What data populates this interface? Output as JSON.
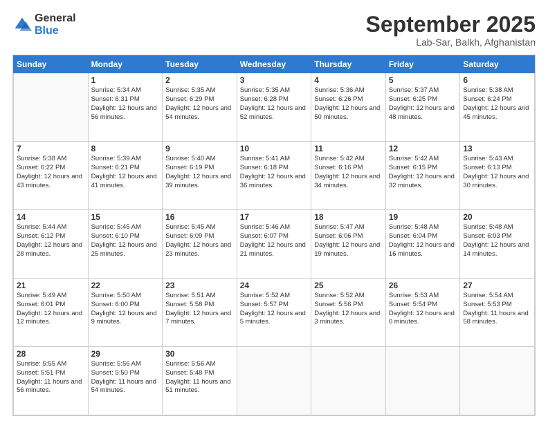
{
  "logo": {
    "general": "General",
    "blue": "Blue"
  },
  "header": {
    "month": "September 2025",
    "location": "Lab-Sar, Balkh, Afghanistan"
  },
  "weekdays": [
    "Sunday",
    "Monday",
    "Tuesday",
    "Wednesday",
    "Thursday",
    "Friday",
    "Saturday"
  ],
  "weeks": [
    [
      {
        "num": "",
        "sunrise": "",
        "sunset": "",
        "daylight": ""
      },
      {
        "num": "1",
        "sunrise": "Sunrise: 5:34 AM",
        "sunset": "Sunset: 6:31 PM",
        "daylight": "Daylight: 12 hours and 56 minutes."
      },
      {
        "num": "2",
        "sunrise": "Sunrise: 5:35 AM",
        "sunset": "Sunset: 6:29 PM",
        "daylight": "Daylight: 12 hours and 54 minutes."
      },
      {
        "num": "3",
        "sunrise": "Sunrise: 5:35 AM",
        "sunset": "Sunset: 6:28 PM",
        "daylight": "Daylight: 12 hours and 52 minutes."
      },
      {
        "num": "4",
        "sunrise": "Sunrise: 5:36 AM",
        "sunset": "Sunset: 6:26 PM",
        "daylight": "Daylight: 12 hours and 50 minutes."
      },
      {
        "num": "5",
        "sunrise": "Sunrise: 5:37 AM",
        "sunset": "Sunset: 6:25 PM",
        "daylight": "Daylight: 12 hours and 48 minutes."
      },
      {
        "num": "6",
        "sunrise": "Sunrise: 5:38 AM",
        "sunset": "Sunset: 6:24 PM",
        "daylight": "Daylight: 12 hours and 45 minutes."
      }
    ],
    [
      {
        "num": "7",
        "sunrise": "Sunrise: 5:38 AM",
        "sunset": "Sunset: 6:22 PM",
        "daylight": "Daylight: 12 hours and 43 minutes."
      },
      {
        "num": "8",
        "sunrise": "Sunrise: 5:39 AM",
        "sunset": "Sunset: 6:21 PM",
        "daylight": "Daylight: 12 hours and 41 minutes."
      },
      {
        "num": "9",
        "sunrise": "Sunrise: 5:40 AM",
        "sunset": "Sunset: 6:19 PM",
        "daylight": "Daylight: 12 hours and 39 minutes."
      },
      {
        "num": "10",
        "sunrise": "Sunrise: 5:41 AM",
        "sunset": "Sunset: 6:18 PM",
        "daylight": "Daylight: 12 hours and 36 minutes."
      },
      {
        "num": "11",
        "sunrise": "Sunrise: 5:42 AM",
        "sunset": "Sunset: 6:16 PM",
        "daylight": "Daylight: 12 hours and 34 minutes."
      },
      {
        "num": "12",
        "sunrise": "Sunrise: 5:42 AM",
        "sunset": "Sunset: 6:15 PM",
        "daylight": "Daylight: 12 hours and 32 minutes."
      },
      {
        "num": "13",
        "sunrise": "Sunrise: 5:43 AM",
        "sunset": "Sunset: 6:13 PM",
        "daylight": "Daylight: 12 hours and 30 minutes."
      }
    ],
    [
      {
        "num": "14",
        "sunrise": "Sunrise: 5:44 AM",
        "sunset": "Sunset: 6:12 PM",
        "daylight": "Daylight: 12 hours and 28 minutes."
      },
      {
        "num": "15",
        "sunrise": "Sunrise: 5:45 AM",
        "sunset": "Sunset: 6:10 PM",
        "daylight": "Daylight: 12 hours and 25 minutes."
      },
      {
        "num": "16",
        "sunrise": "Sunrise: 5:45 AM",
        "sunset": "Sunset: 6:09 PM",
        "daylight": "Daylight: 12 hours and 23 minutes."
      },
      {
        "num": "17",
        "sunrise": "Sunrise: 5:46 AM",
        "sunset": "Sunset: 6:07 PM",
        "daylight": "Daylight: 12 hours and 21 minutes."
      },
      {
        "num": "18",
        "sunrise": "Sunrise: 5:47 AM",
        "sunset": "Sunset: 6:06 PM",
        "daylight": "Daylight: 12 hours and 19 minutes."
      },
      {
        "num": "19",
        "sunrise": "Sunrise: 5:48 AM",
        "sunset": "Sunset: 6:04 PM",
        "daylight": "Daylight: 12 hours and 16 minutes."
      },
      {
        "num": "20",
        "sunrise": "Sunrise: 5:48 AM",
        "sunset": "Sunset: 6:03 PM",
        "daylight": "Daylight: 12 hours and 14 minutes."
      }
    ],
    [
      {
        "num": "21",
        "sunrise": "Sunrise: 5:49 AM",
        "sunset": "Sunset: 6:01 PM",
        "daylight": "Daylight: 12 hours and 12 minutes."
      },
      {
        "num": "22",
        "sunrise": "Sunrise: 5:50 AM",
        "sunset": "Sunset: 6:00 PM",
        "daylight": "Daylight: 12 hours and 9 minutes."
      },
      {
        "num": "23",
        "sunrise": "Sunrise: 5:51 AM",
        "sunset": "Sunset: 5:58 PM",
        "daylight": "Daylight: 12 hours and 7 minutes."
      },
      {
        "num": "24",
        "sunrise": "Sunrise: 5:52 AM",
        "sunset": "Sunset: 5:57 PM",
        "daylight": "Daylight: 12 hours and 5 minutes."
      },
      {
        "num": "25",
        "sunrise": "Sunrise: 5:52 AM",
        "sunset": "Sunset: 5:56 PM",
        "daylight": "Daylight: 12 hours and 3 minutes."
      },
      {
        "num": "26",
        "sunrise": "Sunrise: 5:53 AM",
        "sunset": "Sunset: 5:54 PM",
        "daylight": "Daylight: 12 hours and 0 minutes."
      },
      {
        "num": "27",
        "sunrise": "Sunrise: 5:54 AM",
        "sunset": "Sunset: 5:53 PM",
        "daylight": "Daylight: 11 hours and 58 minutes."
      }
    ],
    [
      {
        "num": "28",
        "sunrise": "Sunrise: 5:55 AM",
        "sunset": "Sunset: 5:51 PM",
        "daylight": "Daylight: 11 hours and 56 minutes."
      },
      {
        "num": "29",
        "sunrise": "Sunrise: 5:56 AM",
        "sunset": "Sunset: 5:50 PM",
        "daylight": "Daylight: 11 hours and 54 minutes."
      },
      {
        "num": "30",
        "sunrise": "Sunrise: 5:56 AM",
        "sunset": "Sunset: 5:48 PM",
        "daylight": "Daylight: 11 hours and 51 minutes."
      },
      {
        "num": "",
        "sunrise": "",
        "sunset": "",
        "daylight": ""
      },
      {
        "num": "",
        "sunrise": "",
        "sunset": "",
        "daylight": ""
      },
      {
        "num": "",
        "sunrise": "",
        "sunset": "",
        "daylight": ""
      },
      {
        "num": "",
        "sunrise": "",
        "sunset": "",
        "daylight": ""
      }
    ]
  ]
}
